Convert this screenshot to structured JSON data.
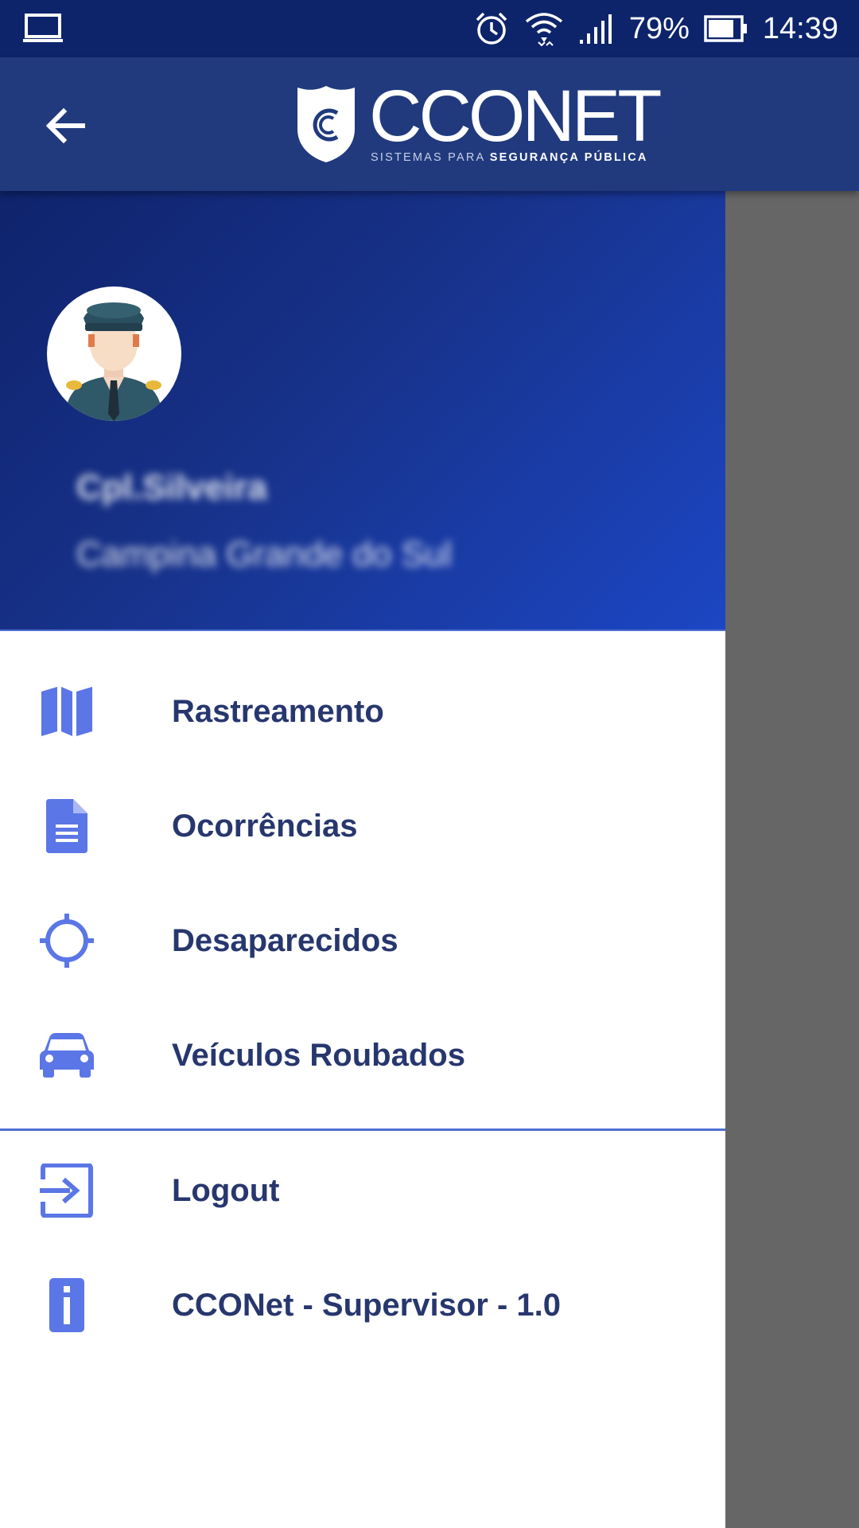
{
  "status_bar": {
    "battery": "79%",
    "time": "14:39",
    "icons": [
      "laptop-icon",
      "alarm-icon",
      "wifi-icon",
      "signal-icon",
      "battery-icon"
    ]
  },
  "app_bar": {
    "back_icon": "arrow-left-icon",
    "brand": "CCONET",
    "tagline_part1": "SISTEMAS PARA ",
    "tagline_part2": "SEGURANÇA PÚBLICA"
  },
  "drawer": {
    "user": {
      "name": "Cpl.Silveira",
      "city": "Campina Grande do Sul"
    },
    "menu": [
      {
        "label": "Rastreamento",
        "icon": "map-icon"
      },
      {
        "label": "Ocorrências",
        "icon": "document-icon"
      },
      {
        "label": "Desaparecidos",
        "icon": "crosshair-icon"
      },
      {
        "label": "Veículos Roubados",
        "icon": "car-icon"
      }
    ],
    "footer_menu": [
      {
        "label": "Logout",
        "icon": "logout-icon"
      },
      {
        "label": "CCONet - Supervisor - 1.0",
        "icon": "info-icon"
      }
    ]
  },
  "colors": {
    "status_bar": "#0d246b",
    "app_bar": "#213a7e",
    "accent_icon": "#5b76e6",
    "menu_text": "#27376e",
    "scrim": "#666666"
  }
}
